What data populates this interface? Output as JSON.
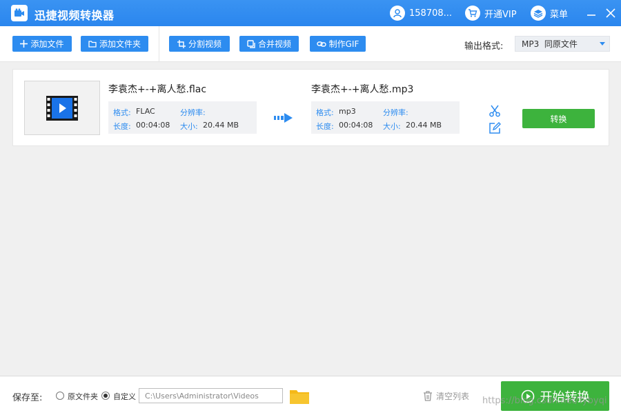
{
  "app": {
    "title": "迅捷视频转换器"
  },
  "titlebar": {
    "user_label": "158708...",
    "vip_label": "开通VIP",
    "menu_label": "菜单"
  },
  "toolbar": {
    "add_file": "添加文件",
    "add_folder": "添加文件夹",
    "split_video": "分割视频",
    "merge_video": "合并视频",
    "make_gif": "制作GIF",
    "output_format_label": "输出格式:",
    "output_format_value": "MP3  同原文件"
  },
  "file_item": {
    "source": {
      "name": "李袁杰+-+离人愁.flac",
      "format_label": "格式:",
      "format_value": "FLAC",
      "resolution_label": "分辨率:",
      "resolution_value": "",
      "duration_label": "长度:",
      "duration_value": "00:04:08",
      "size_label": "大小:",
      "size_value": "20.44 MB"
    },
    "target": {
      "name": "李袁杰+-+离人愁.mp3",
      "format_label": "格式:",
      "format_value": "mp3",
      "resolution_label": "分辨率:",
      "resolution_value": "",
      "duration_label": "长度:",
      "duration_value": "00:04:08",
      "size_label": "大小:",
      "size_value": "20.44 MB"
    },
    "convert_label": "转换"
  },
  "footer": {
    "save_to_label": "保存至:",
    "option_original": "原文件夹",
    "option_custom": "自定义",
    "selected_option": "custom",
    "path_value": "C:\\Users\\Administrator\\Videos",
    "clear_list_label": "清空列表",
    "start_label": "开始转换",
    "watermark": "https://blog.csdn.net/Tybyqi"
  },
  "colors": {
    "accent": "#2d8cf0",
    "green": "#3db33d",
    "titlebar": "#2d8cf0",
    "folder": "#f5b918"
  }
}
